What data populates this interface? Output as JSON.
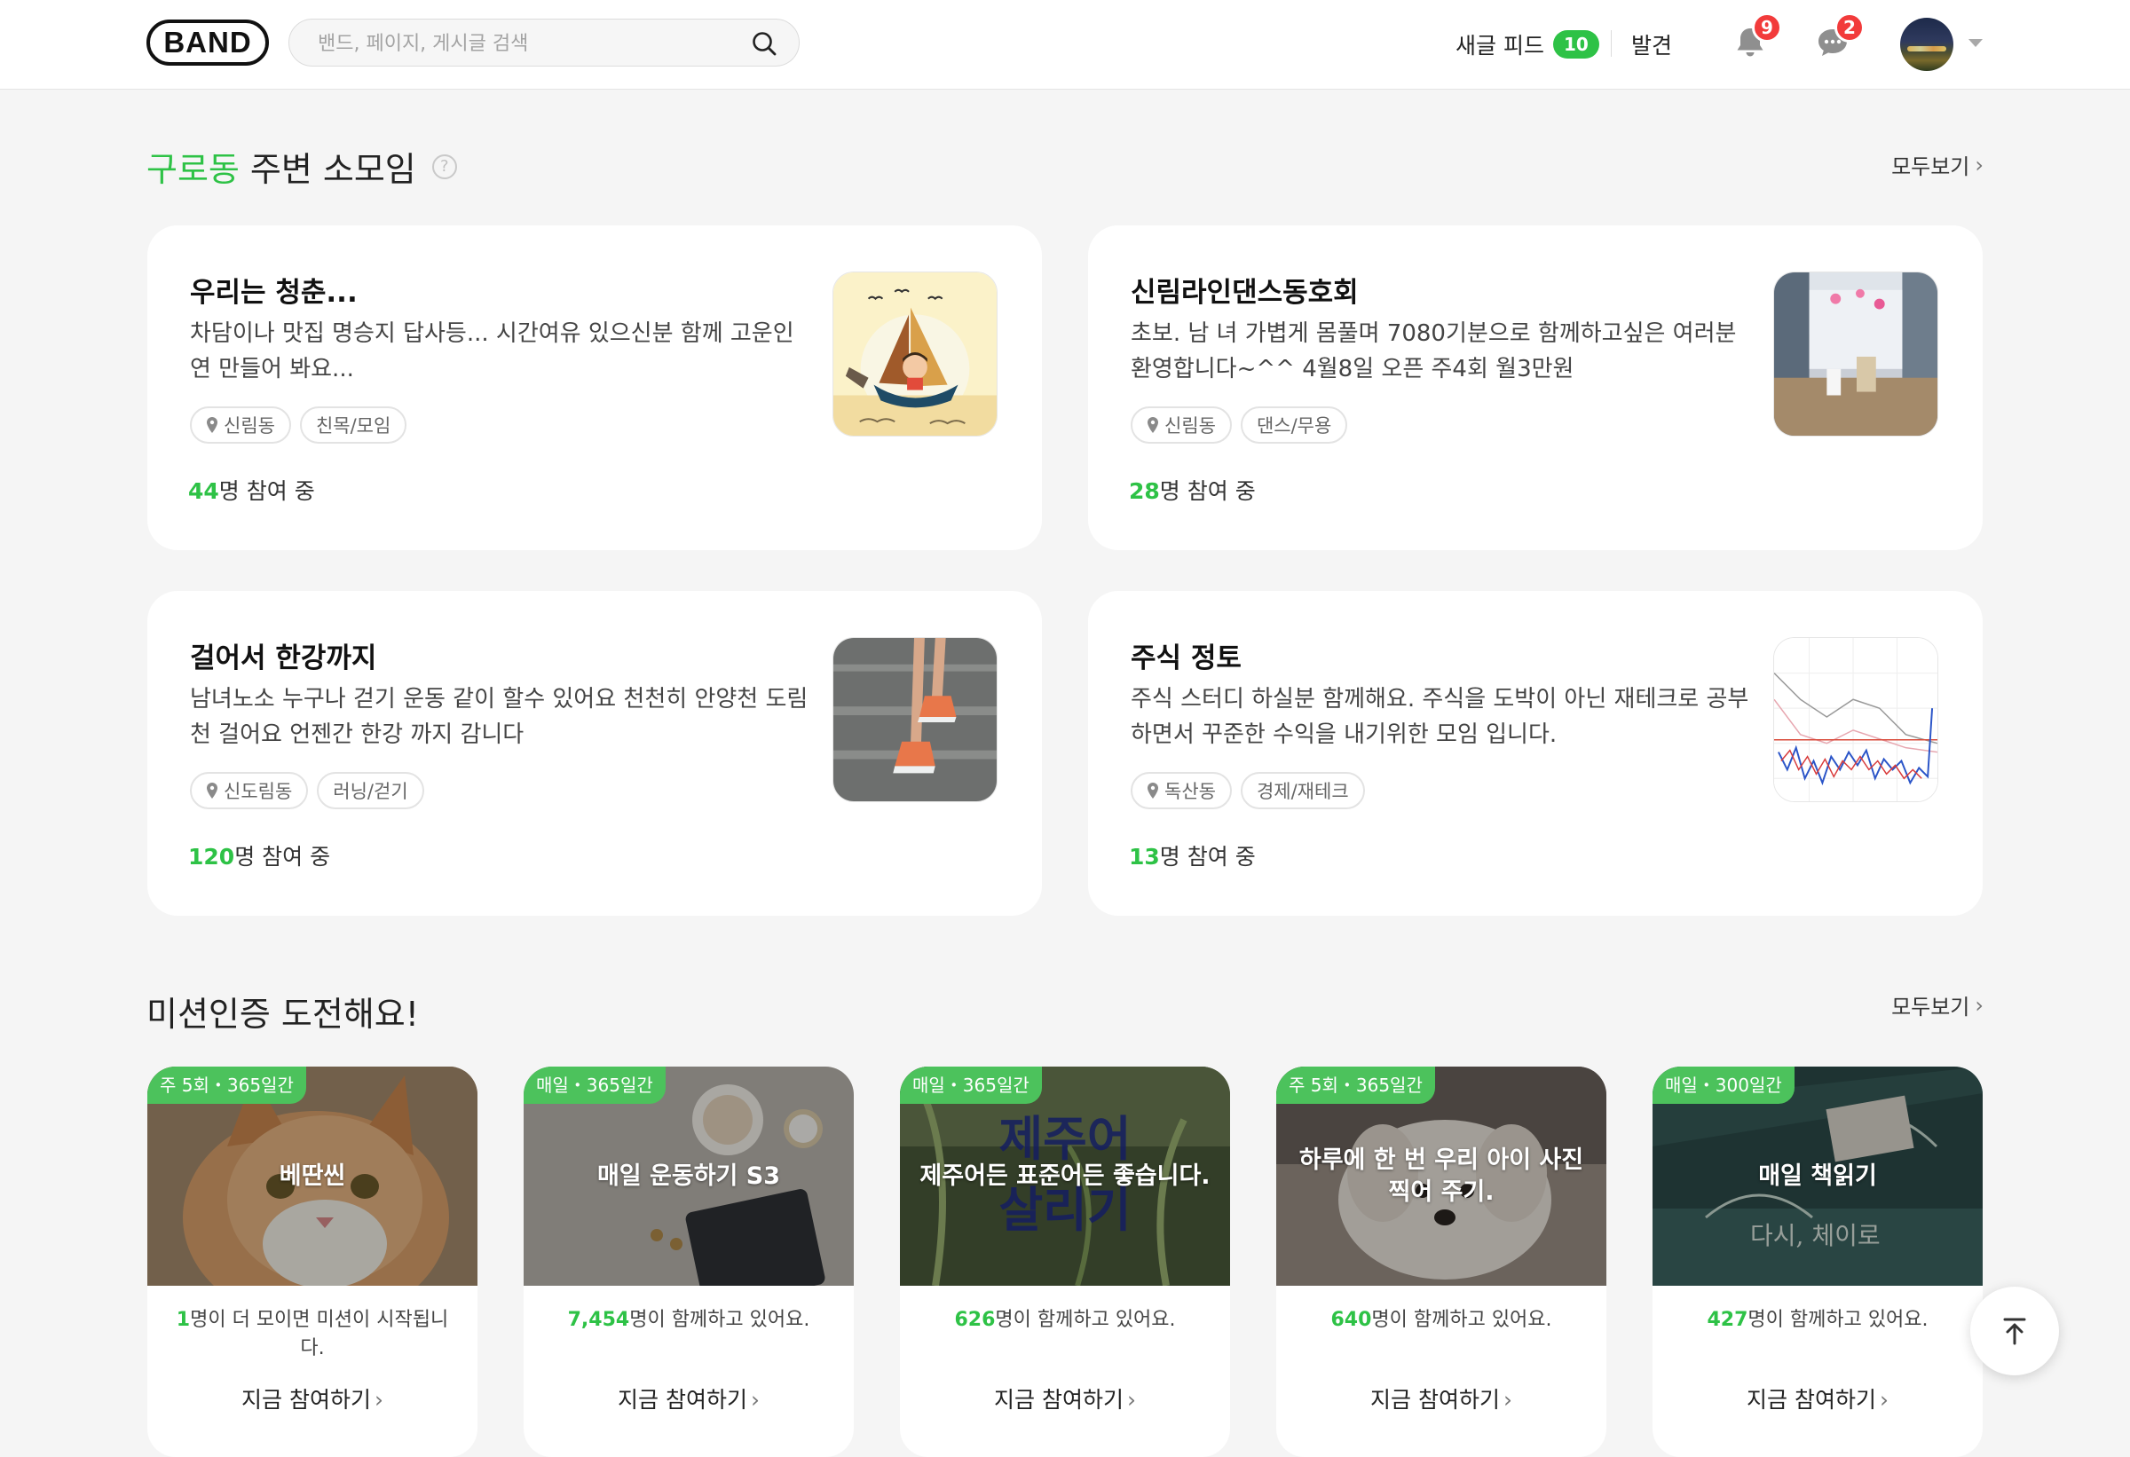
{
  "header": {
    "logo": "BAND",
    "search_placeholder": "밴드, 페이지, 게시글 검색",
    "new_feed_label": "새글 피드",
    "new_feed_count": "10",
    "discover_label": "발견",
    "notification_count": "9",
    "chat_count": "2",
    "accent_color": "#2ec246",
    "badge_color": "#f23b3b"
  },
  "nearby": {
    "location": "구로동",
    "title_rest": "주변 소모임",
    "help_icon": "?",
    "see_all": "모두보기",
    "groups": [
      {
        "name": "우리는 청춘...",
        "desc": "차담이나 맛집 명승지 답사등... 시간여유 있으신분 함께 고운인연 만들어 봐요...",
        "location": "신림동",
        "category": "친목/모임",
        "count": "44",
        "count_suffix": "명 참여 중"
      },
      {
        "name": "신림라인댄스동호회",
        "desc": "초보. 남 녀 가볍게 몸풀며 7080기분으로 함께하고싶은 여러분 환영합니다~^^ 4월8일 오픈 주4회 월3만원",
        "location": "신림동",
        "category": "댄스/무용",
        "count": "28",
        "count_suffix": "명 참여 중"
      },
      {
        "name": "걸어서 한강까지",
        "desc": "남녀노소 누구나 걷기 운동 같이 할수 있어요 천천히 안양천 도림천 걸어요 언젠간 한강 까지 감니다",
        "location": "신도림동",
        "category": "러닝/걷기",
        "count": "120",
        "count_suffix": "명 참여 중"
      },
      {
        "name": "주식 정토",
        "desc": "주식 스터디 하실분 함께해요. 주식을 도박이 아닌 재테크로 공부하면서 꾸준한 수익을 내기위한 모임 입니다.",
        "location": "독산동",
        "category": "경제/재테크",
        "count": "13",
        "count_suffix": "명 참여 중"
      }
    ]
  },
  "missions": {
    "title": "미션인증 도전해요!",
    "see_all": "모두보기",
    "join_label": "지금 참여하기",
    "items": [
      {
        "period": "주 5회・365일간",
        "title": "베딴씬",
        "count": "1",
        "stat_text": "명이 더 모이면 미션이 시작됩니다."
      },
      {
        "period": "매일・365일간",
        "title": "매일 운동하기 S3",
        "count": "7,454",
        "stat_text": "명이 함께하고 있어요."
      },
      {
        "period": "매일・365일간",
        "title": "제주어든 표준어든 좋습니다.",
        "count": "626",
        "stat_text": "명이 함께하고 있어요."
      },
      {
        "period": "주 5회・365일간",
        "title": "하루에 한 번 우리 아이 사진 찍어 주기.",
        "count": "640",
        "stat_text": "명이 함께하고 있어요."
      },
      {
        "period": "매일・300일간",
        "title": "매일 책읽기",
        "count": "427",
        "stat_text": "명이 함께하고 있어요."
      }
    ]
  }
}
